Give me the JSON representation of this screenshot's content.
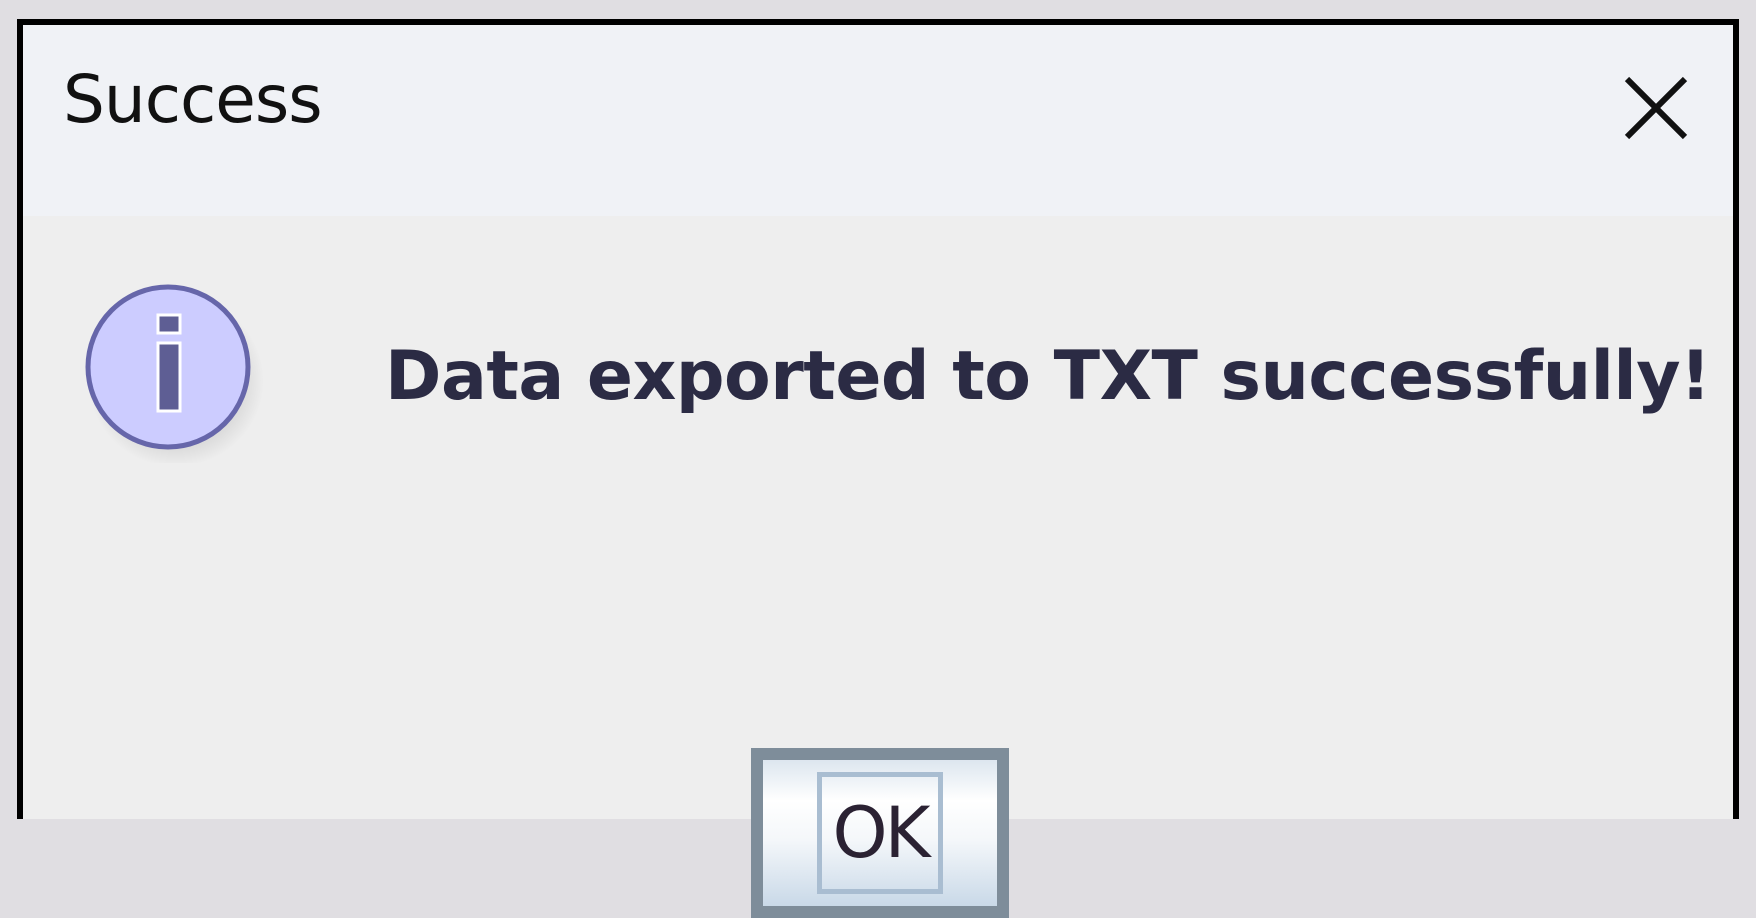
{
  "dialog": {
    "title": "Success",
    "close_icon": "close-icon",
    "message_icon": "information-icon",
    "message": "Data exported to TXT successfully!",
    "ok_label": "OK"
  },
  "colors": {
    "titlebar_bg": "#f0f2f6",
    "content_bg": "#eeeeee",
    "border": "#000000",
    "icon_fill": "#ccccff",
    "icon_stroke": "#6666aa",
    "button_border": "#7e8d9a"
  }
}
